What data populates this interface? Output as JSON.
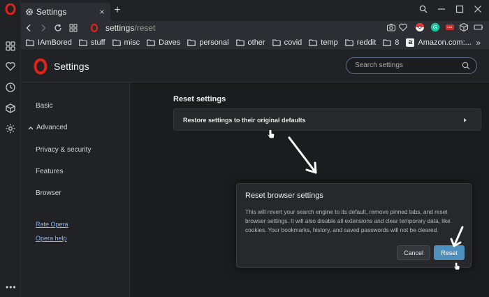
{
  "tab": {
    "title": "Settings",
    "close_glyph": "×"
  },
  "new_tab_glyph": "+",
  "address": {
    "host": "settings",
    "path": "/reset"
  },
  "bookmarks": [
    {
      "label": "IAmBored",
      "icon": "folder-icon"
    },
    {
      "label": "stuff",
      "icon": "folder-icon"
    },
    {
      "label": "misc",
      "icon": "folder-icon"
    },
    {
      "label": "Daves",
      "icon": "folder-icon"
    },
    {
      "label": "personal",
      "icon": "folder-icon"
    },
    {
      "label": "other",
      "icon": "folder-icon"
    },
    {
      "label": "covid",
      "icon": "folder-icon"
    },
    {
      "label": "temp",
      "icon": "folder-icon"
    },
    {
      "label": "reddit",
      "icon": "folder-icon"
    },
    {
      "label": "8",
      "icon": "folder-icon"
    },
    {
      "label": "Amazon.com:...",
      "icon": "amazon-icon"
    }
  ],
  "bookmarks_more": "»",
  "settings": {
    "title": "Settings",
    "search_placeholder": "Search settings"
  },
  "nav": {
    "basic": "Basic",
    "advanced": "Advanced",
    "privacy": "Privacy & security",
    "features": "Features",
    "browser": "Browser",
    "rate": "Rate Opera",
    "help": "Opera help"
  },
  "main": {
    "section_title": "Reset settings",
    "restore_label": "Restore settings to their original defaults"
  },
  "dialog": {
    "title": "Reset browser settings",
    "body": "This will revert your search engine to its default, remove pinned tabs, and reset browser settings. It will also disable all extensions and clear temporary data, like cookies. Your bookmarks, history, and saved passwords will not be cleared.",
    "cancel": "Cancel",
    "reset": "Reset"
  },
  "sidebar_more": "•••",
  "colors": {
    "accent": "#4d8fbd",
    "opera_red": "#e0241b",
    "link": "#8ab4f8"
  }
}
